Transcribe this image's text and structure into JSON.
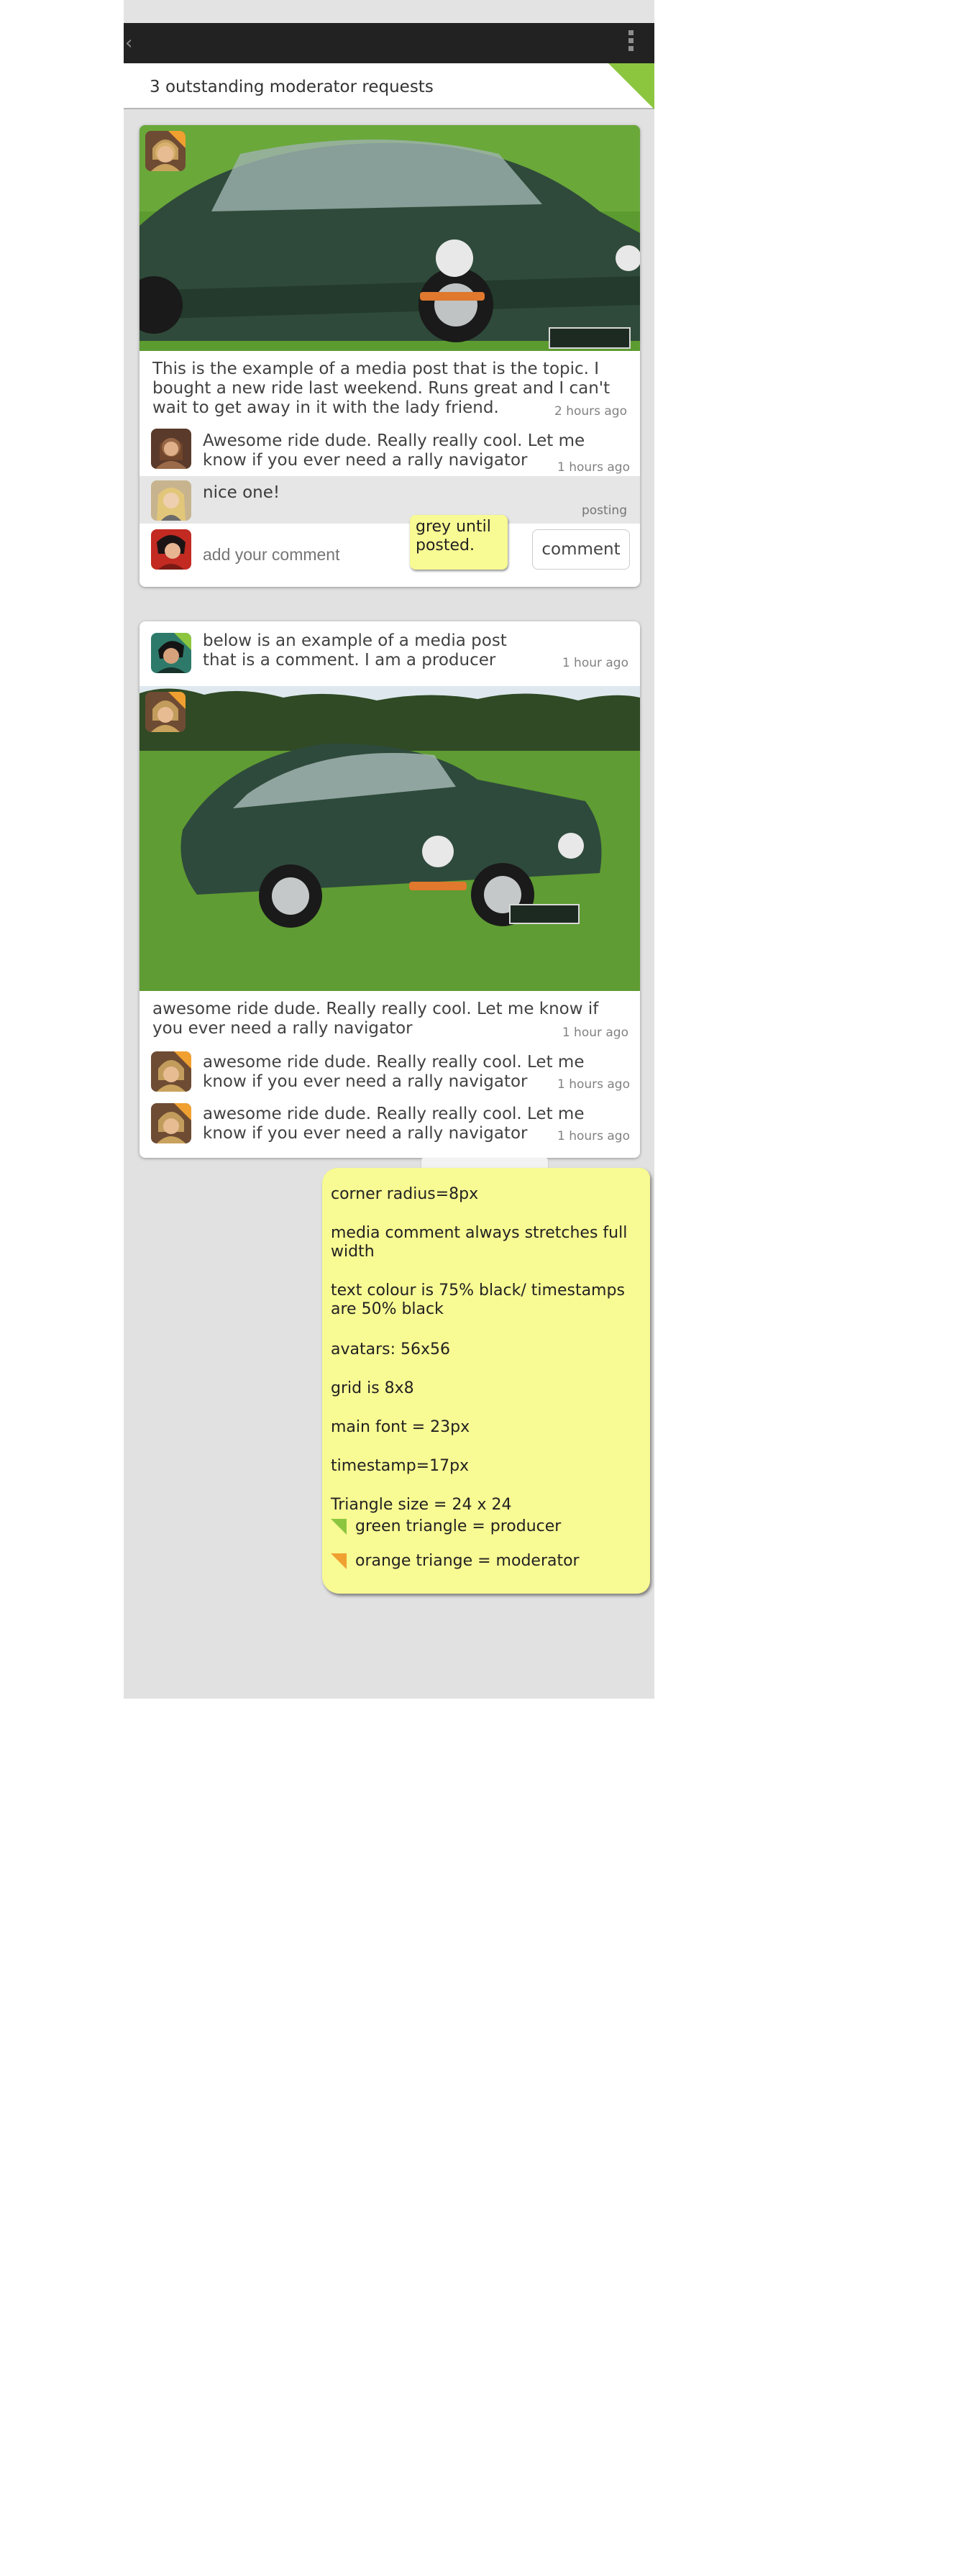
{
  "action_bar": {
    "back_glyph": "‹",
    "back_icon": "chevron-left-icon",
    "menu_icon": "overflow-menu-icon"
  },
  "request_bar": {
    "text": "3 outstanding moderator requests",
    "accent": "#8cc63f"
  },
  "post1": {
    "caption": "This is the example of a media post that is the topic. I bought a new ride last weekend. Runs great and I can't wait to get away in it with the lady friend.",
    "timestamp": "2 hours ago",
    "comments": [
      {
        "text": "Awesome ride dude. Really really cool. Let me know if you ever need a rally navigator",
        "timestamp": "1 hours ago"
      },
      {
        "text": "nice one!",
        "timestamp": "posting"
      }
    ],
    "input_placeholder": "add your comment",
    "comment_button": "comment"
  },
  "note_small": "grey until posted.",
  "post2": {
    "header_text": "below is an example of a media post that is a comment. I am a producer",
    "header_timestamp": "1 hour ago",
    "caption": "awesome ride dude. Really really cool. Let me know if you ever need a rally navigator",
    "caption_timestamp": "1 hour ago",
    "comments": [
      {
        "text": "awesome ride dude. Really really cool. Let me know if you ever need a rally navigator",
        "timestamp": "1 hours ago"
      },
      {
        "text": "awesome ride dude. Really really cool. Let me know if you ever need a rally navigator",
        "timestamp": "1 hours ago"
      }
    ]
  },
  "note_big": {
    "lines": [
      "corner radius=8px",
      "media comment always stretches full width",
      "text colour is 75% black/ timestamps are 50% black",
      "avatars: 56x56",
      "grid is 8x8",
      "main font = 23px",
      "timestamp=17px",
      "Triangle size = 24 x 24"
    ],
    "legend_producer": "green triangle = producer",
    "legend_moderator": "orange triange = moderator"
  },
  "colors": {
    "producer": "#8cc63f",
    "moderator": "#f0a030",
    "sticky": "#f8fa93",
    "action_bar": "#222222",
    "background": "#e1e1e1"
  }
}
